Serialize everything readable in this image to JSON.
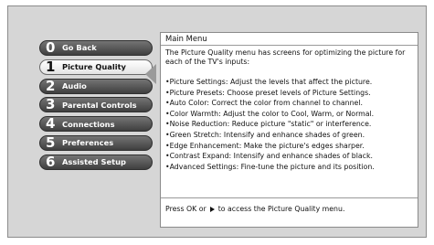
{
  "menu": {
    "items": [
      {
        "number": "0",
        "label": "Go Back"
      },
      {
        "number": "1",
        "label": "Picture Quality"
      },
      {
        "number": "2",
        "label": "Audio"
      },
      {
        "number": "3",
        "label": "Parental Controls"
      },
      {
        "number": "4",
        "label": "Connections"
      },
      {
        "number": "5",
        "label": "Preferences"
      },
      {
        "number": "6",
        "label": "Assisted Setup"
      }
    ],
    "selected_index": 1
  },
  "panel": {
    "title": "Main Menu",
    "intro": "The Picture Quality menu has screens for optimizing the picture for each of the TV's inputs:",
    "bullets": [
      "•Picture Settings: Adjust the levels that affect the picture.",
      "•Picture Presets: Choose preset levels of Picture Settings.",
      "•Auto Color: Correct the color from channel to channel.",
      "•Color Warmth: Adjust the color to Cool, Warm, or Normal.",
      "•Noise Reduction: Reduce picture \"static\" or interference.",
      "•Green Stretch: Intensify and enhance shades of green.",
      "•Edge Enhancement: Make the picture's edges sharper.",
      "•Contrast Expand: Intensify and enhance shades of black.",
      "•Advanced Settings: Fine-tune the picture and its position."
    ],
    "footer": {
      "prefix": "Press OK or",
      "icon": "play-arrow-icon",
      "suffix": "to access the Picture Quality menu."
    }
  }
}
